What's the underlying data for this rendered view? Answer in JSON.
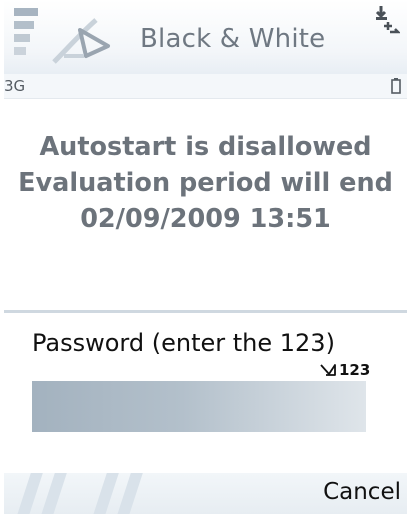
{
  "titlebar": {
    "title": "Black & White",
    "logo_icon": "app-logo-icon",
    "signal_icon": "signal-strength-icon",
    "connection_icon": "data-connection-icon"
  },
  "status": {
    "network": "3G",
    "battery_icon": "battery-icon"
  },
  "message": {
    "line1": "Autostart is disallowed",
    "line2": "Evaluation period will end",
    "line3": "02/09/2009 13:51"
  },
  "password": {
    "label": "Password (enter the 123)",
    "input_mode": "123",
    "input_mode_icon": "input-mode-icon",
    "value": ""
  },
  "softkeys": {
    "right": "Cancel"
  },
  "colors": {
    "text_gray": "#6c737b",
    "input_fill": "#a3b2bf",
    "divider": "#cfd8e0"
  }
}
